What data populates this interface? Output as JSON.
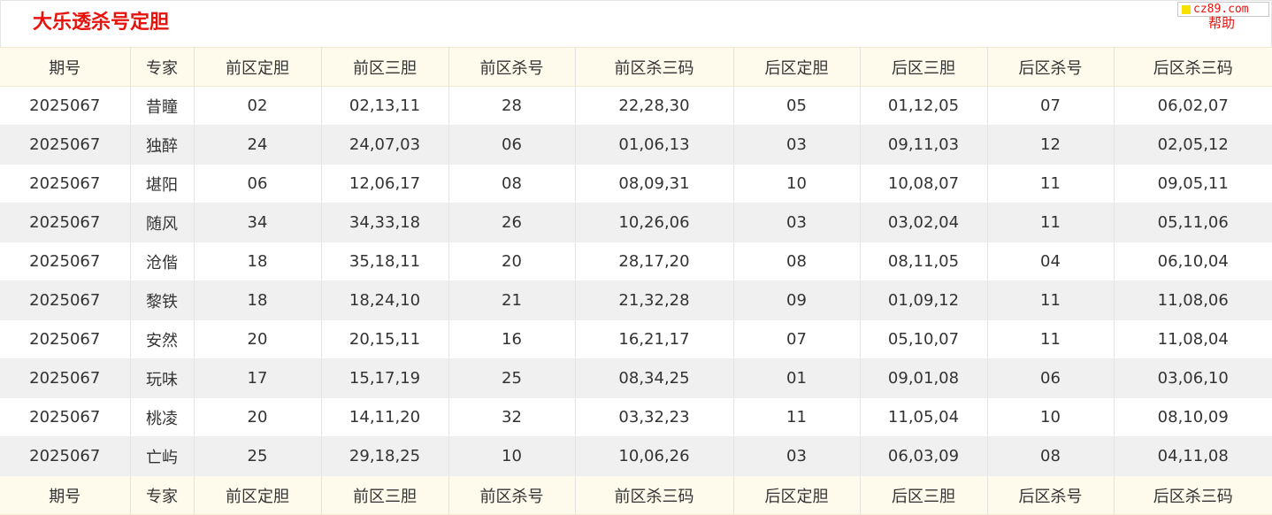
{
  "page": {
    "title": "大乐透杀号定胆",
    "brand_text": "cz89.com",
    "help_label": "帮助",
    "colors": {
      "title": "#e8120c",
      "header_bg": "#fffbec",
      "stripe_bg": "#f0f0f0",
      "brand_square": "#f6e100"
    }
  },
  "table": {
    "headers": [
      "期号",
      "专家",
      "前区定胆",
      "前区三胆",
      "前区杀号",
      "前区杀三码",
      "后区定胆",
      "后区三胆",
      "后区杀号",
      "后区杀三码"
    ],
    "rows": [
      [
        "2025067",
        "昔瞳",
        "02",
        "02,13,11",
        "28",
        "22,28,30",
        "05",
        "01,12,05",
        "07",
        "06,02,07"
      ],
      [
        "2025067",
        "独醉",
        "24",
        "24,07,03",
        "06",
        "01,06,13",
        "03",
        "09,11,03",
        "12",
        "02,05,12"
      ],
      [
        "2025067",
        "堪阳",
        "06",
        "12,06,17",
        "08",
        "08,09,31",
        "10",
        "10,08,07",
        "11",
        "09,05,11"
      ],
      [
        "2025067",
        "随风",
        "34",
        "34,33,18",
        "26",
        "10,26,06",
        "03",
        "03,02,04",
        "11",
        "05,11,06"
      ],
      [
        "2025067",
        "沧偕",
        "18",
        "35,18,11",
        "20",
        "28,17,20",
        "08",
        "08,11,05",
        "04",
        "06,10,04"
      ],
      [
        "2025067",
        "黎铁",
        "18",
        "18,24,10",
        "21",
        "21,32,28",
        "09",
        "01,09,12",
        "11",
        "11,08,06"
      ],
      [
        "2025067",
        "安然",
        "20",
        "20,15,11",
        "16",
        "16,21,17",
        "07",
        "05,10,07",
        "11",
        "11,08,04"
      ],
      [
        "2025067",
        "玩味",
        "17",
        "15,17,19",
        "25",
        "08,34,25",
        "01",
        "09,01,08",
        "06",
        "03,06,10"
      ],
      [
        "2025067",
        "桃凌",
        "20",
        "14,11,20",
        "32",
        "03,32,23",
        "11",
        "11,05,04",
        "10",
        "08,10,09"
      ],
      [
        "2025067",
        "亡屿",
        "25",
        "29,18,25",
        "10",
        "10,06,26",
        "03",
        "06,03,09",
        "08",
        "04,11,08"
      ]
    ]
  }
}
